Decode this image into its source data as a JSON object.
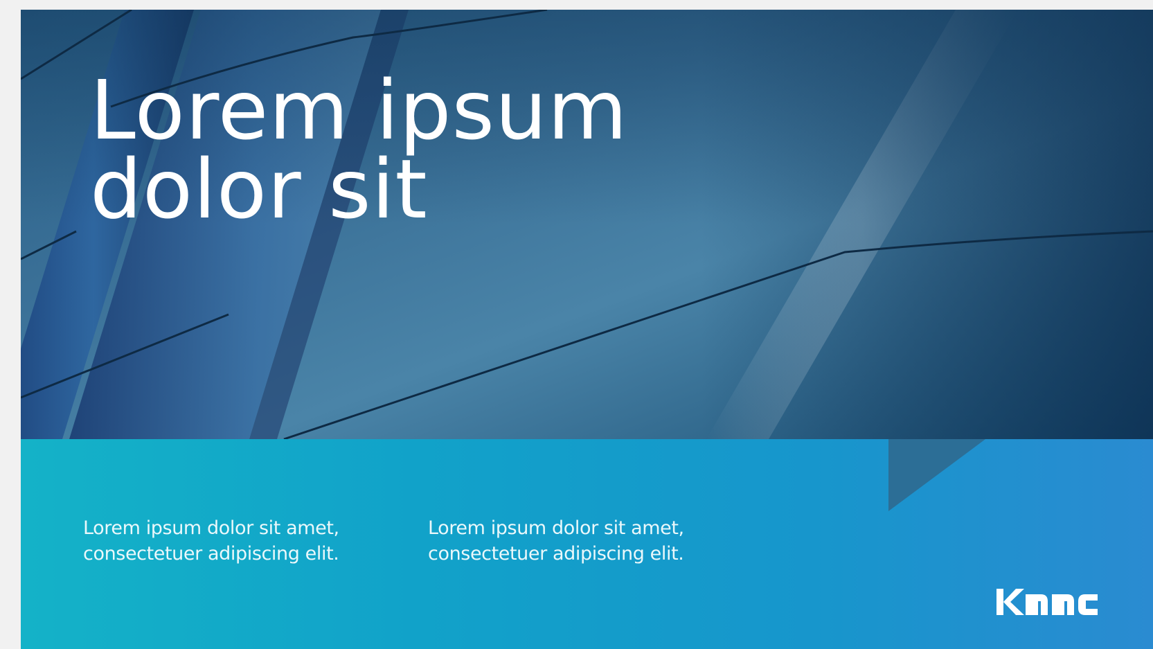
{
  "document": {
    "title_lines": [
      "Lorem ipsum",
      "dolor sit"
    ],
    "columns": [
      {
        "lines": [
          "Lorem ipsum dolor sit amet,",
          "consectetuer adipiscing elit."
        ]
      },
      {
        "lines": [
          "Lorem ipsum dolor sit amet,",
          "consectetuer adipiscing elit."
        ]
      }
    ],
    "logo_text": "KMMC"
  },
  "colors": {
    "hero_dark": "#163a5e",
    "hero_mid": "#3f7aa0",
    "band_left": "#14b2c8",
    "band_right": "#2a8bd1",
    "text": "#ffffff"
  }
}
